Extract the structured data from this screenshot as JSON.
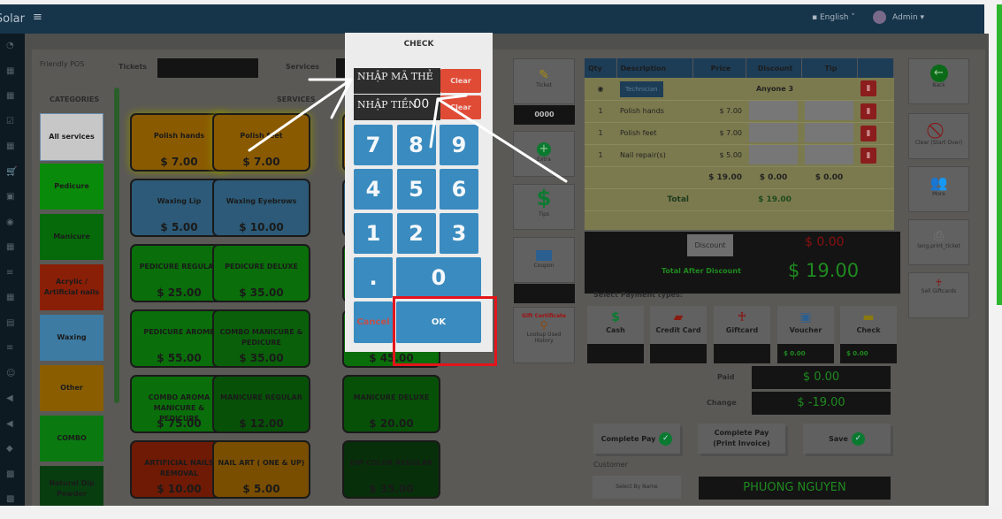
{
  "header": {
    "brand": "Solar",
    "language": "English",
    "user": "Admin",
    "menu_icon": "hamburger-icon"
  },
  "sidebar": {
    "icons": [
      "dashboard-icon",
      "calendar-icon",
      "calendar-icon",
      "calendar-check-icon",
      "calendar-icon",
      "cart-icon",
      "briefcase-icon",
      "eye-icon",
      "calendar-icon",
      "list-icon",
      "calendar-icon",
      "files-icon",
      "list-icon",
      "smile-icon",
      "megaphone-icon",
      "megaphone-icon",
      "tag-icon",
      "gift-icon",
      "gift-icon"
    ]
  },
  "pos": {
    "app_label": "Friendly POS",
    "tickets_label": "Tickets",
    "services_label": "Services",
    "categories_heading": "CATEGORIES",
    "services_heading": "SERVICES"
  },
  "categories": [
    {
      "label": "All services",
      "color": "#c7c7c7"
    },
    {
      "label": "Pedicure",
      "color": "#0a8a0a"
    },
    {
      "label": "Manicure",
      "color": "#066a0a"
    },
    {
      "label": "Acrylic / Artificial nails",
      "color": "#8a1f08"
    },
    {
      "label": "Waxing",
      "color": "#3d7ba3"
    },
    {
      "label": "Other",
      "color": "#8a5e00"
    },
    {
      "label": "COMBO",
      "color": "#0a7a10"
    },
    {
      "label": "Natural Dip Powder",
      "color": "#083d10"
    }
  ],
  "services": [
    {
      "name": "Polish hands",
      "price": "$ 7.00",
      "color": "#8a5a00"
    },
    {
      "name": "Polish feet",
      "price": "$ 7.00",
      "color": "#8a5a00"
    },
    {
      "name": "",
      "price": "",
      "color": "#8a5a00"
    },
    {
      "name": "Waxing Lip",
      "price": "$ 5.00",
      "color": "#2c5a78"
    },
    {
      "name": "Waxing Eyebrows",
      "price": "$ 10.00",
      "color": "#2c5a78"
    },
    {
      "name": "",
      "price": "",
      "color": "#2c5a78"
    },
    {
      "name": "PEDICURE REGULAR",
      "price": "$ 25.00",
      "color": "#0a6e0a"
    },
    {
      "name": "PEDICURE DELUXE",
      "price": "$ 35.00",
      "color": "#0a6e0a"
    },
    {
      "name": "",
      "price": "",
      "color": "#0a6e0a"
    },
    {
      "name": "PEDICURE AROME",
      "price": "$ 55.00",
      "color": "#0a6e0a"
    },
    {
      "name": "COMBO MANICURE & PEDICURE",
      "price": "$ 35.00",
      "color": "#0a600a"
    },
    {
      "name": "",
      "price": "$ 45.00",
      "color": "#0a6e0a"
    },
    {
      "name": "COMBO AROMA MANICURE & PEDICURE",
      "price": "$ 75.00",
      "color": "#0a6e0a"
    },
    {
      "name": "MANICURE REGULAR",
      "price": "$ 12.00",
      "color": "#075008"
    },
    {
      "name": "MANICURE DELUXE",
      "price": "$ 20.00",
      "color": "#075008"
    },
    {
      "name": "ARTIFICIAL NAILS REMOVAL",
      "price": "$ 10.00",
      "color": "#6e1a05"
    },
    {
      "name": "NAIL ART ( ONE & UP)",
      "price": "$ 5.00",
      "color": "#7a4e00"
    },
    {
      "name": "DIP COLOR REGULAR",
      "price": "$ 35.00",
      "color": "#07300a"
    }
  ],
  "left_tools": {
    "ticket": "Ticket",
    "ticket_number": "0000",
    "extra": "Extra",
    "tips": "Tips",
    "coupon": "Coupon",
    "gift_cert": "Gift Certificate",
    "lookup": "Lookup Used History"
  },
  "cart": {
    "headers": [
      "Qty",
      "Description",
      "Price",
      "Discount",
      "Tip"
    ],
    "technician_button": "Technician",
    "technician": "Anyone 3",
    "rows": [
      {
        "qty": "1",
        "desc": "Polish hands",
        "price": "$ 7.00"
      },
      {
        "qty": "1",
        "desc": "Polish feet",
        "price": "$ 7.00"
      },
      {
        "qty": "1",
        "desc": "Nail repair(s)",
        "price": "$ 5.00"
      }
    ],
    "subtotal_price": "$ 19.00",
    "subtotal_discount": "$ 0.00",
    "subtotal_tip": "$ 0.00",
    "total_label": "Total",
    "total": "$ 19.00"
  },
  "discount": {
    "button": "Discount",
    "value": "$ 0.00",
    "after_label": "Total After Discount",
    "after_value": "$ 19.00"
  },
  "payment": {
    "heading": "Select Payment types:",
    "types": [
      {
        "label": "Cash",
        "value": ""
      },
      {
        "label": "Credit Card",
        "value": ""
      },
      {
        "label": "Giftcard",
        "value": ""
      },
      {
        "label": "Voucher",
        "value": "$ 0.00"
      },
      {
        "label": "Check",
        "value": "$ 0.00"
      }
    ],
    "paid_label": "Paid",
    "paid": "$ 0.00",
    "change_label": "Change",
    "change": "$ -19.00"
  },
  "actions": {
    "complete": "Complete Pay",
    "complete_print": "Complete Pay (Print Invoice)",
    "save": "Save"
  },
  "customer": {
    "label": "Customer",
    "select_button": "Select By Name",
    "name": "PHUONG NGUYEN"
  },
  "right_tools": {
    "back": "Back",
    "clear": "Clear (Start Over)",
    "more": "More",
    "print": "lang.print_ticket",
    "sell": "Sell Giftcards"
  },
  "modal": {
    "title": "CHECK",
    "field1": "NHẬP MÃ THẺ",
    "field2": "NHẬP TIỀN",
    "field2_value": "00",
    "clear": "Clear",
    "keys": [
      "7",
      "8",
      "9",
      "4",
      "5",
      "6",
      "1",
      "2",
      "3",
      ".",
      "0"
    ],
    "cancel": "Cancel",
    "ok": "OK"
  },
  "colors": {
    "navbar": "#16344a",
    "keypad": "#3a8bbf",
    "clear": "#e04b36",
    "highlight": "#e3151b",
    "money_green": "#1f8a1f"
  }
}
